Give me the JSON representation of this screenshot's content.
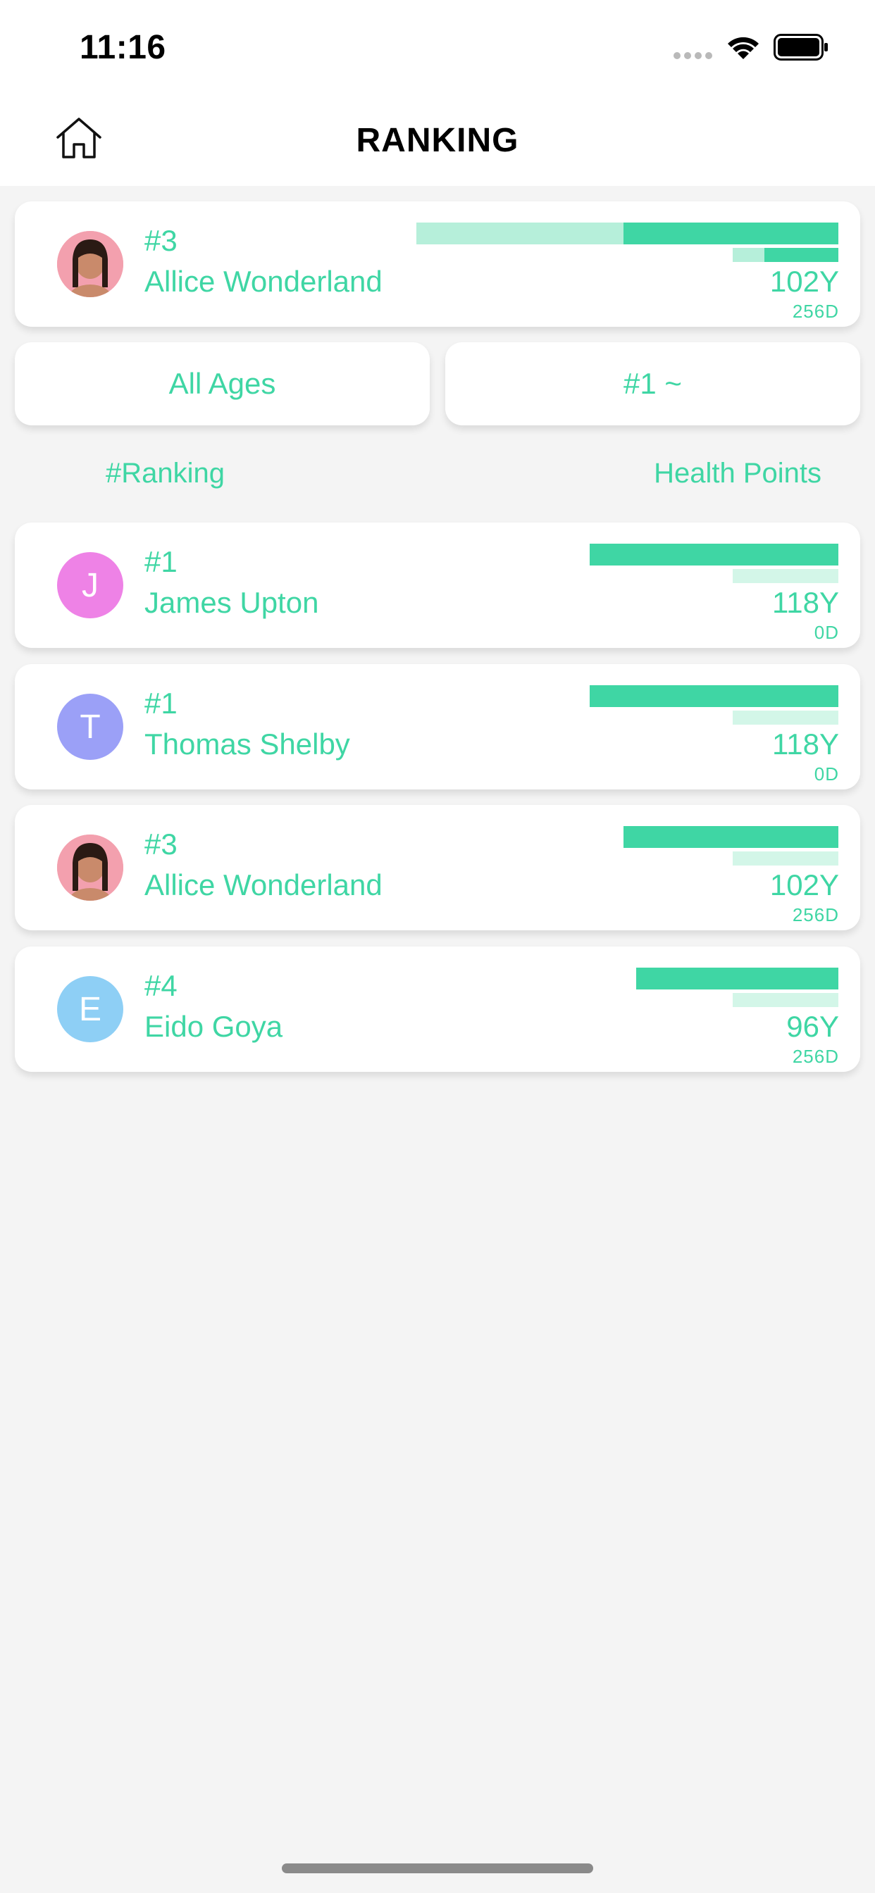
{
  "status_bar": {
    "time": "11:16"
  },
  "header": {
    "title": "RANKING"
  },
  "my_card": {
    "rank": "#3",
    "name": "Allice Wonderland",
    "years": "102Y",
    "days": "256D",
    "avatar": "photo"
  },
  "filters": {
    "age": "All Ages",
    "range": "#1 ~"
  },
  "columns": {
    "left": "#Ranking",
    "right": "Health Points"
  },
  "ranking": [
    {
      "rank": "#1",
      "name": "James Upton",
      "years": "118Y",
      "days": "0D",
      "avatar_letter": "J",
      "avatar_color": "#ee82e6"
    },
    {
      "rank": "#1",
      "name": "Thomas Shelby",
      "years": "118Y",
      "days": "0D",
      "avatar_letter": "T",
      "avatar_color": "#9ba0f7"
    },
    {
      "rank": "#3",
      "name": "Allice Wonderland",
      "years": "102Y",
      "days": "256D",
      "avatar_letter": "",
      "avatar_color": "#f3a0ae"
    },
    {
      "rank": "#4",
      "name": "Eido Goya",
      "years": "96Y",
      "days": "256D",
      "avatar_letter": "E",
      "avatar_color": "#8ecff5"
    }
  ],
  "colors": {
    "accent": "#3fd6a4",
    "accent_light": "#d3f6e8",
    "background": "#f4f4f4"
  }
}
